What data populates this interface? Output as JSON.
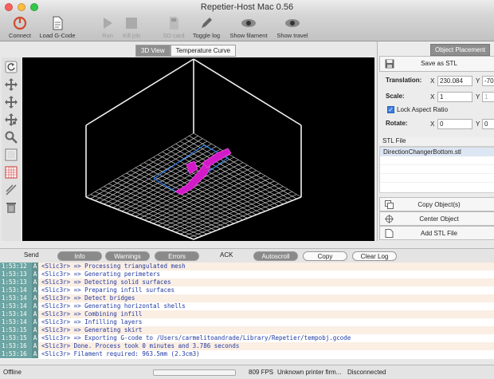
{
  "window": {
    "title": "Repetier-Host Mac 0.56"
  },
  "toolbar": {
    "connect": "Connect",
    "load_gcode": "Load G-Code",
    "run": "Run",
    "kill_job": "Kill job",
    "sd_card": "SD card",
    "toggle_log": "Toggle log",
    "show_filament": "Show filament",
    "show_travel": "Show travel"
  },
  "view_tabs": {
    "view3d": "3D View",
    "temperature": "Temperature Curve"
  },
  "left_tools": [
    "refresh-icon",
    "rotate-icon",
    "move-icon",
    "move-all-icon",
    "zoom-icon",
    "front-view-icon",
    "grid-icon",
    "lines-icon",
    "trash-icon"
  ],
  "right_panel": {
    "tab": "Object Placement",
    "save_button": "Save as STL",
    "translation": {
      "label": "Translation:",
      "x_axis": "X",
      "x": "230.084",
      "y_axis": "Y",
      "y": "-70"
    },
    "scale": {
      "label": "Scale:",
      "x_axis": "X",
      "x": "1",
      "y_axis": "Y",
      "y": "1"
    },
    "lock_aspect": "Lock Aspect Ratio",
    "rotate": {
      "label": "Rotate:",
      "x_axis": "X",
      "x": "0",
      "y_axis": "Y",
      "y": "0"
    },
    "stl_header": "STL File",
    "stl_files": [
      "DirectionChangerBottom.stl"
    ],
    "copy_button": "Copy Object(s)",
    "center_button": "Center Object",
    "add_button": "Add STL File"
  },
  "log_toolbar": {
    "send": "Send",
    "info": "Info",
    "warnings": "Warnings",
    "errors": "Errors",
    "ack": "ACK",
    "autoscroll": "Autoscroll",
    "copy": "Copy",
    "clear": "Clear Log"
  },
  "log": [
    {
      "time": "1:53:12",
      "kind": "A",
      "msg": "<Slic3r> => Processing triangulated mesh"
    },
    {
      "time": "1:53:13",
      "kind": "A",
      "msg": "<Slic3r> => Generating perimeters"
    },
    {
      "time": "1:53:13",
      "kind": "A",
      "msg": "<Slic3r> => Detecting solid surfaces"
    },
    {
      "time": "1:53:14",
      "kind": "A",
      "msg": "<Slic3r> => Preparing infill surfaces"
    },
    {
      "time": "1:53:14",
      "kind": "A",
      "msg": "<Slic3r> => Detect bridges"
    },
    {
      "time": "1:53:14",
      "kind": "A",
      "msg": "<Slic3r> => Generating horizontal shells"
    },
    {
      "time": "1:53:14",
      "kind": "A",
      "msg": "<Slic3r> => Combining infill"
    },
    {
      "time": "1:53:14",
      "kind": "A",
      "msg": "<Slic3r> => Infilling layers"
    },
    {
      "time": "1:53:15",
      "kind": "A",
      "msg": "<Slic3r> => Generating skirt"
    },
    {
      "time": "1:53:15",
      "kind": "A",
      "msg": "<Slic3r> => Exporting G-code to /Users/carmelitoandrade/Library/Repetier/tempobj.gcode"
    },
    {
      "time": "1:53:16",
      "kind": "A",
      "msg": "<Slic3r> Done. Process took 0 minutes and 3.786 seconds"
    },
    {
      "time": "1:53:16",
      "kind": "A",
      "msg": "<Slic3r> Filament required: 963.5mm (2.3cm3)"
    }
  ],
  "status": {
    "connection": "Offline",
    "progress": 0,
    "fps": "809 FPS",
    "firmware": "Unknown printer firm...",
    "state": "Disconnected"
  }
}
